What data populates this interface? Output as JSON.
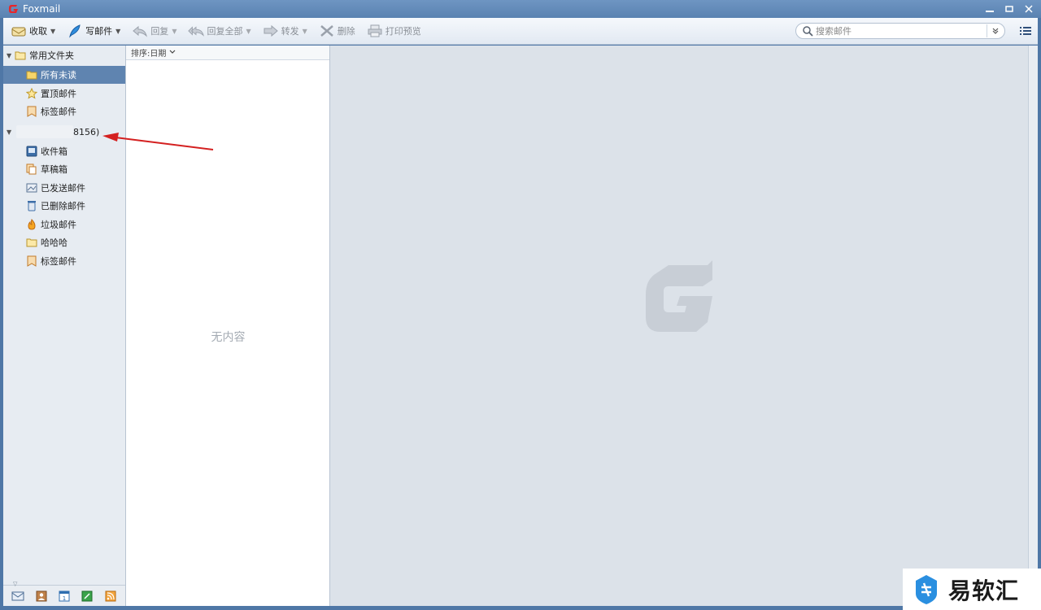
{
  "window": {
    "title": "Foxmail",
    "controls": [
      "minimize",
      "maximize",
      "close"
    ]
  },
  "toolbar": {
    "buttons": [
      {
        "label": "收取",
        "icon": "receive-icon",
        "has_dropdown": true,
        "enabled": true
      },
      {
        "label": "写邮件",
        "icon": "compose-pen-icon",
        "has_dropdown": true,
        "enabled": true
      },
      {
        "label": "回复",
        "icon": "reply-icon",
        "has_dropdown": true,
        "enabled": false
      },
      {
        "label": "回复全部",
        "icon": "reply-all-icon",
        "has_dropdown": true,
        "enabled": false
      },
      {
        "label": "转发",
        "icon": "forward-icon",
        "has_dropdown": true,
        "enabled": false
      },
      {
        "label": "删除",
        "icon": "delete-icon",
        "has_dropdown": false,
        "enabled": false
      },
      {
        "label": "打印预览",
        "icon": "print-icon",
        "has_dropdown": false,
        "enabled": false
      }
    ],
    "search": {
      "placeholder": "搜索邮件",
      "value": ""
    }
  },
  "sidebar": {
    "common_folders": {
      "label": "常用文件夹",
      "items": [
        {
          "label": "所有未读",
          "icon": "folder-icon",
          "selected": true
        },
        {
          "label": "置顶邮件",
          "icon": "star-icon",
          "selected": false
        },
        {
          "label": "标签邮件",
          "icon": "tag-icon",
          "selected": false
        }
      ]
    },
    "account": {
      "label_visible": "8156)",
      "items": [
        {
          "label": "收件箱",
          "icon": "inbox-icon"
        },
        {
          "label": "草稿箱",
          "icon": "drafts-icon"
        },
        {
          "label": "已发送邮件",
          "icon": "sent-icon"
        },
        {
          "label": "已删除邮件",
          "icon": "trash-icon"
        },
        {
          "label": "垃圾邮件",
          "icon": "spam-icon"
        },
        {
          "label": "哈哈哈",
          "icon": "folder-icon"
        },
        {
          "label": "标签邮件",
          "icon": "tag-icon"
        }
      ]
    },
    "bottom_icons": [
      "mail-icon",
      "contacts-icon",
      "calendar-icon",
      "notes-icon",
      "rss-icon"
    ]
  },
  "mail_list": {
    "sort_label": "排序:日期",
    "empty_text": "无内容"
  },
  "watermark": {
    "text": "易软汇"
  },
  "colors": {
    "title_bar": "#5a82b1",
    "selected_item": "#5f84b0",
    "preview_bg": "#dce2e9",
    "annotation_arrow": "#d42020"
  }
}
